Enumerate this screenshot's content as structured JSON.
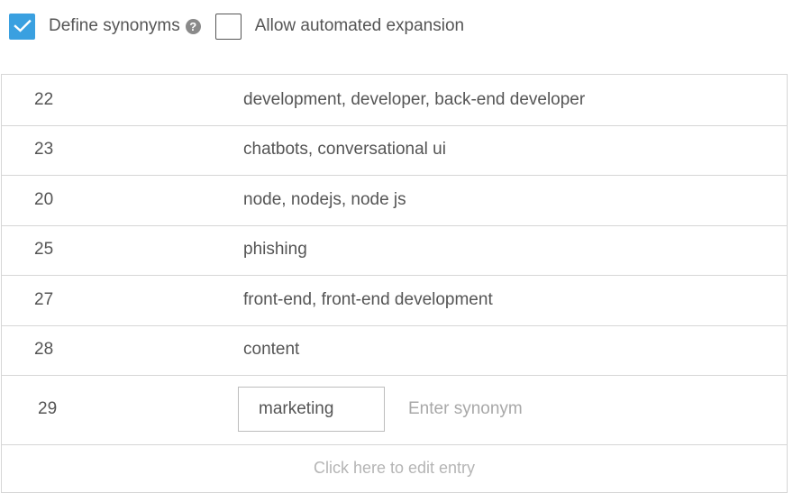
{
  "options": {
    "define_synonyms": {
      "label": "Define synonyms",
      "checked": true,
      "help_icon": "question-circle-icon"
    },
    "automated_expansion": {
      "label": "Allow automated expansion",
      "checked": false
    },
    "accent_color": "#3aa0e0"
  },
  "table": {
    "rows": [
      {
        "id": "22",
        "synonyms": "development, developer, back-end developer"
      },
      {
        "id": "23",
        "synonyms": "chatbots, conversational ui"
      },
      {
        "id": "20",
        "synonyms": "node, nodejs, node js"
      },
      {
        "id": "25",
        "synonyms": "phishing"
      },
      {
        "id": "27",
        "synonyms": "front-end, front-end development"
      },
      {
        "id": "28",
        "synonyms": "content"
      }
    ],
    "edit_row": {
      "id": "29",
      "input_value": "marketing",
      "synonym_placeholder": "Enter synonym"
    },
    "footer_label": "Click here to edit entry"
  }
}
